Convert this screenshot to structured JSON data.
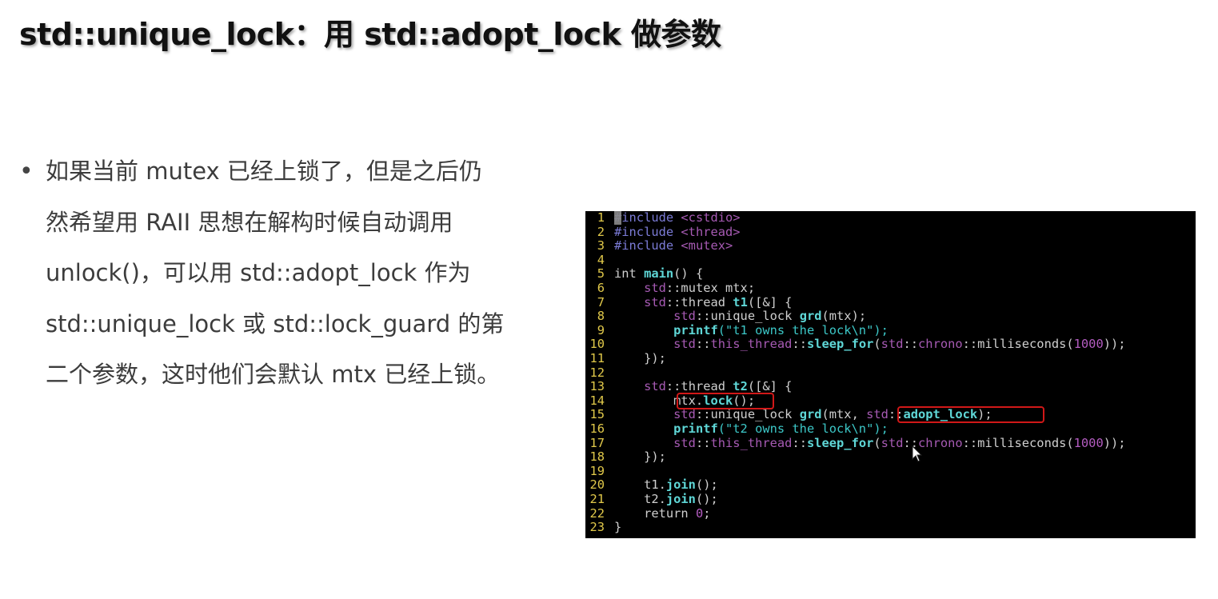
{
  "title": "std::unique_lock：用 std::adopt_lock 做参数",
  "bullet": {
    "symbol": "•",
    "lines": [
      "如果当前 mutex 已经上锁了，但是之后仍",
      "然希望用 RAII 思想在解构时候自动调用",
      "unlock()，可以用 std::adopt_lock 作为",
      "std::unique_lock 或 std::lock_guard 的第",
      "二个参数，这时他们会默认 mtx 已经上锁。"
    ]
  },
  "code": {
    "colors": {
      "background": "#000000",
      "line_number": "#e0c84a",
      "plain": "#cfcfcf",
      "preproc": "#7b7bd6",
      "string": "#3cc7c7",
      "keyword": "#5fd7d7",
      "namespace": "#a65ab3",
      "number": "#b35cc0",
      "highlight_box": "#d11818"
    },
    "lines": [
      {
        "n": "1",
        "segments": [
          [
            "#include ",
            "preproc"
          ],
          [
            "<cstdio>",
            "namespace"
          ]
        ]
      },
      {
        "n": "2",
        "segments": [
          [
            "#include ",
            "preproc"
          ],
          [
            "<thread>",
            "namespace"
          ]
        ]
      },
      {
        "n": "3",
        "segments": [
          [
            "#include ",
            "preproc"
          ],
          [
            "<mutex>",
            "namespace"
          ]
        ]
      },
      {
        "n": "4",
        "segments": []
      },
      {
        "n": "5",
        "segments": [
          [
            "int ",
            "plain"
          ],
          [
            "main",
            "fn"
          ],
          [
            "() {",
            "plain"
          ]
        ]
      },
      {
        "n": "6",
        "segments": [
          [
            "    ",
            "plain"
          ],
          [
            "std",
            "namespace"
          ],
          [
            "::mutex mtx;",
            "plain"
          ]
        ]
      },
      {
        "n": "7",
        "segments": [
          [
            "    ",
            "plain"
          ],
          [
            "std",
            "namespace"
          ],
          [
            "::thread ",
            "plain"
          ],
          [
            "t1",
            "fn"
          ],
          [
            "([&] {",
            "plain"
          ]
        ]
      },
      {
        "n": "8",
        "segments": [
          [
            "        ",
            "plain"
          ],
          [
            "std",
            "namespace"
          ],
          [
            "::unique_lock ",
            "plain"
          ],
          [
            "grd",
            "fn"
          ],
          [
            "(mtx);",
            "plain"
          ]
        ]
      },
      {
        "n": "9",
        "segments": [
          [
            "        ",
            "plain"
          ],
          [
            "printf",
            "fn"
          ],
          [
            "(\"t1 owns the lock\\n\");",
            "string"
          ]
        ]
      },
      {
        "n": "10",
        "segments": [
          [
            "        ",
            "plain"
          ],
          [
            "std",
            "namespace"
          ],
          [
            "::",
            "plain"
          ],
          [
            "this_thread",
            "namespace"
          ],
          [
            "::",
            "plain"
          ],
          [
            "sleep_for",
            "fn"
          ],
          [
            "(",
            "plain"
          ],
          [
            "std",
            "namespace"
          ],
          [
            "::",
            "plain"
          ],
          [
            "chrono",
            "namespace"
          ],
          [
            "::milliseconds(",
            "plain"
          ],
          [
            "1000",
            "number"
          ],
          [
            "));",
            "plain"
          ]
        ]
      },
      {
        "n": "11",
        "segments": [
          [
            "    });",
            "plain"
          ]
        ]
      },
      {
        "n": "12",
        "segments": []
      },
      {
        "n": "13",
        "segments": [
          [
            "    ",
            "plain"
          ],
          [
            "std",
            "namespace"
          ],
          [
            "::thread ",
            "plain"
          ],
          [
            "t2",
            "fn"
          ],
          [
            "([&] {",
            "plain"
          ]
        ]
      },
      {
        "n": "14",
        "segments": [
          [
            "        mtx.",
            "plain"
          ],
          [
            "lock",
            "fn"
          ],
          [
            "();",
            "plain"
          ]
        ]
      },
      {
        "n": "15",
        "segments": [
          [
            "        ",
            "plain"
          ],
          [
            "std",
            "namespace"
          ],
          [
            "::unique_lock ",
            "plain"
          ],
          [
            "grd",
            "fn"
          ],
          [
            "(mtx, ",
            "plain"
          ],
          [
            "std",
            "namespace"
          ],
          [
            "::",
            "plain"
          ],
          [
            "adopt_lock",
            "fn"
          ],
          [
            ");",
            "plain"
          ]
        ]
      },
      {
        "n": "16",
        "segments": [
          [
            "        ",
            "plain"
          ],
          [
            "printf",
            "fn"
          ],
          [
            "(\"t2 owns the lock\\n\");",
            "string"
          ]
        ]
      },
      {
        "n": "17",
        "segments": [
          [
            "        ",
            "plain"
          ],
          [
            "std",
            "namespace"
          ],
          [
            "::",
            "plain"
          ],
          [
            "this_thread",
            "namespace"
          ],
          [
            "::",
            "plain"
          ],
          [
            "sleep_for",
            "fn"
          ],
          [
            "(",
            "plain"
          ],
          [
            "std",
            "namespace"
          ],
          [
            "::",
            "plain"
          ],
          [
            "chrono",
            "namespace"
          ],
          [
            "::milliseconds(",
            "plain"
          ],
          [
            "1000",
            "number"
          ],
          [
            "));",
            "plain"
          ]
        ]
      },
      {
        "n": "18",
        "segments": [
          [
            "    });",
            "plain"
          ]
        ]
      },
      {
        "n": "19",
        "segments": []
      },
      {
        "n": "20",
        "segments": [
          [
            "    t1.",
            "plain"
          ],
          [
            "join",
            "fn"
          ],
          [
            "();",
            "plain"
          ]
        ]
      },
      {
        "n": "21",
        "segments": [
          [
            "    t2.",
            "plain"
          ],
          [
            "join",
            "fn"
          ],
          [
            "();",
            "plain"
          ]
        ]
      },
      {
        "n": "22",
        "segments": [
          [
            "    return ",
            "plain"
          ],
          [
            "0",
            "number"
          ],
          [
            ";",
            "plain"
          ]
        ]
      },
      {
        "n": "23",
        "segments": [
          [
            "}",
            "plain"
          ]
        ]
      }
    ]
  }
}
